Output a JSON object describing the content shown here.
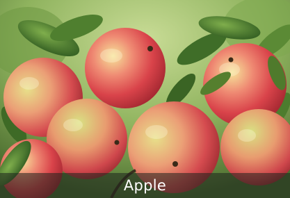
{
  "caption": {
    "text": "Apple",
    "bar_color": "#1e241e",
    "text_color": "#ffffff"
  },
  "photo": {
    "icon": "apple-tree-photo",
    "palette": {
      "apple_red": "#d9434a",
      "apple_yellow": "#e6d25a",
      "leaf_green": "#3d6b2a",
      "background_green": "#9bbf6a"
    }
  }
}
